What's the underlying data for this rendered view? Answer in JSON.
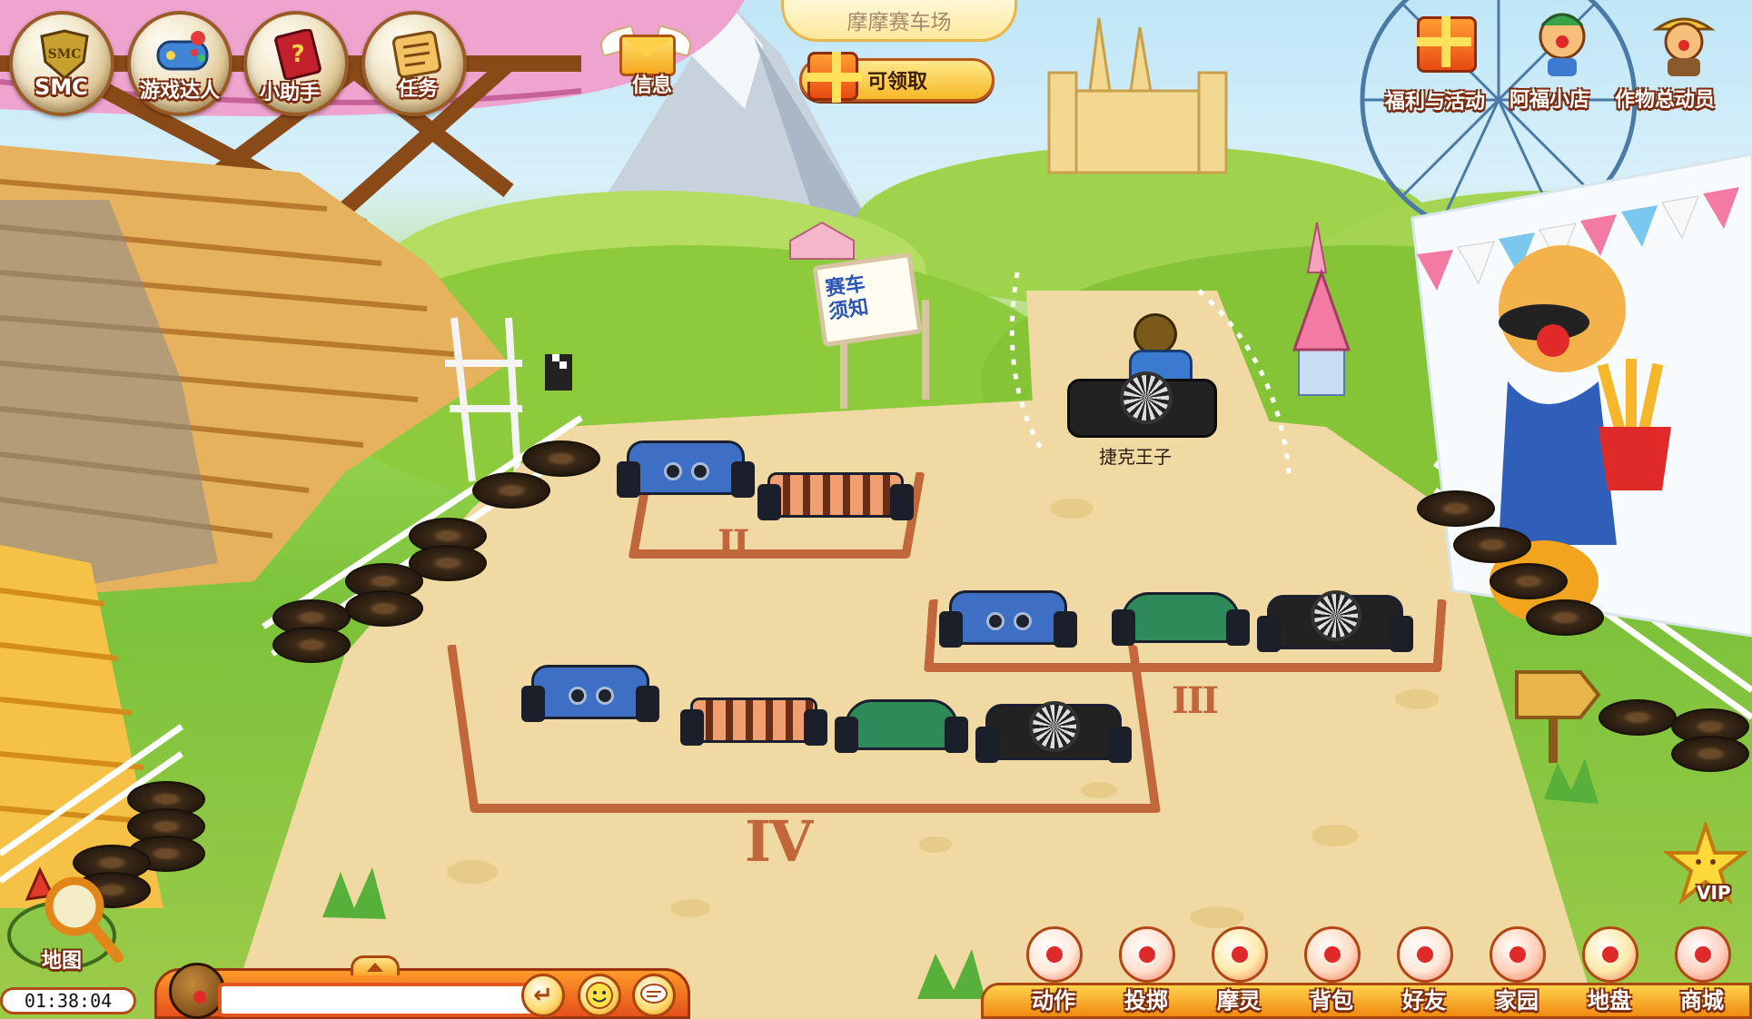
{
  "top": {
    "location_title": "摩摩赛车场",
    "claim_button": "可领取"
  },
  "left_hud": [
    {
      "label": "SMC",
      "badge_text": "SMC",
      "icon": "smc-shield-icon"
    },
    {
      "label": "游戏达人",
      "icon": "gamepad-icon"
    },
    {
      "label": "小助手",
      "icon": "help-book-icon"
    },
    {
      "label": "任务",
      "icon": "task-board-icon"
    }
  ],
  "message": {
    "label": "信息",
    "icon": "winged-envelope-icon"
  },
  "right_hud": [
    {
      "label": "福利与活动",
      "icon": "gift-box-icon"
    },
    {
      "label": "阿福小店",
      "icon": "shopkeeper-icon"
    },
    {
      "label": "作物总动员",
      "icon": "farmer-icon"
    }
  ],
  "scene": {
    "sign_text": "赛车\n须知",
    "player_name": "捷克王子",
    "parking_numerals": [
      "II",
      "III",
      "IV"
    ]
  },
  "bottom": {
    "clock": "01:38:04",
    "map_label": "地图",
    "chat_placeholder": "",
    "vip_label": "VIP",
    "menu": [
      {
        "label": "动作",
        "icon": "action-icon"
      },
      {
        "label": "投掷",
        "icon": "throw-target-icon"
      },
      {
        "label": "摩灵",
        "icon": "moling-pet-icon"
      },
      {
        "label": "背包",
        "icon": "backpack-icon"
      },
      {
        "label": "好友",
        "icon": "friends-icon"
      },
      {
        "label": "家园",
        "icon": "home-icon"
      },
      {
        "label": "地盘",
        "icon": "territory-icon"
      },
      {
        "label": "商城",
        "icon": "mall-icon"
      }
    ]
  },
  "colors": {
    "hud_outline": "#7a2d10",
    "orange_bar": "#f08a12",
    "dirt": "#f1d9a3",
    "grass": "#7cc23a",
    "parking_line": "#c2663c"
  }
}
